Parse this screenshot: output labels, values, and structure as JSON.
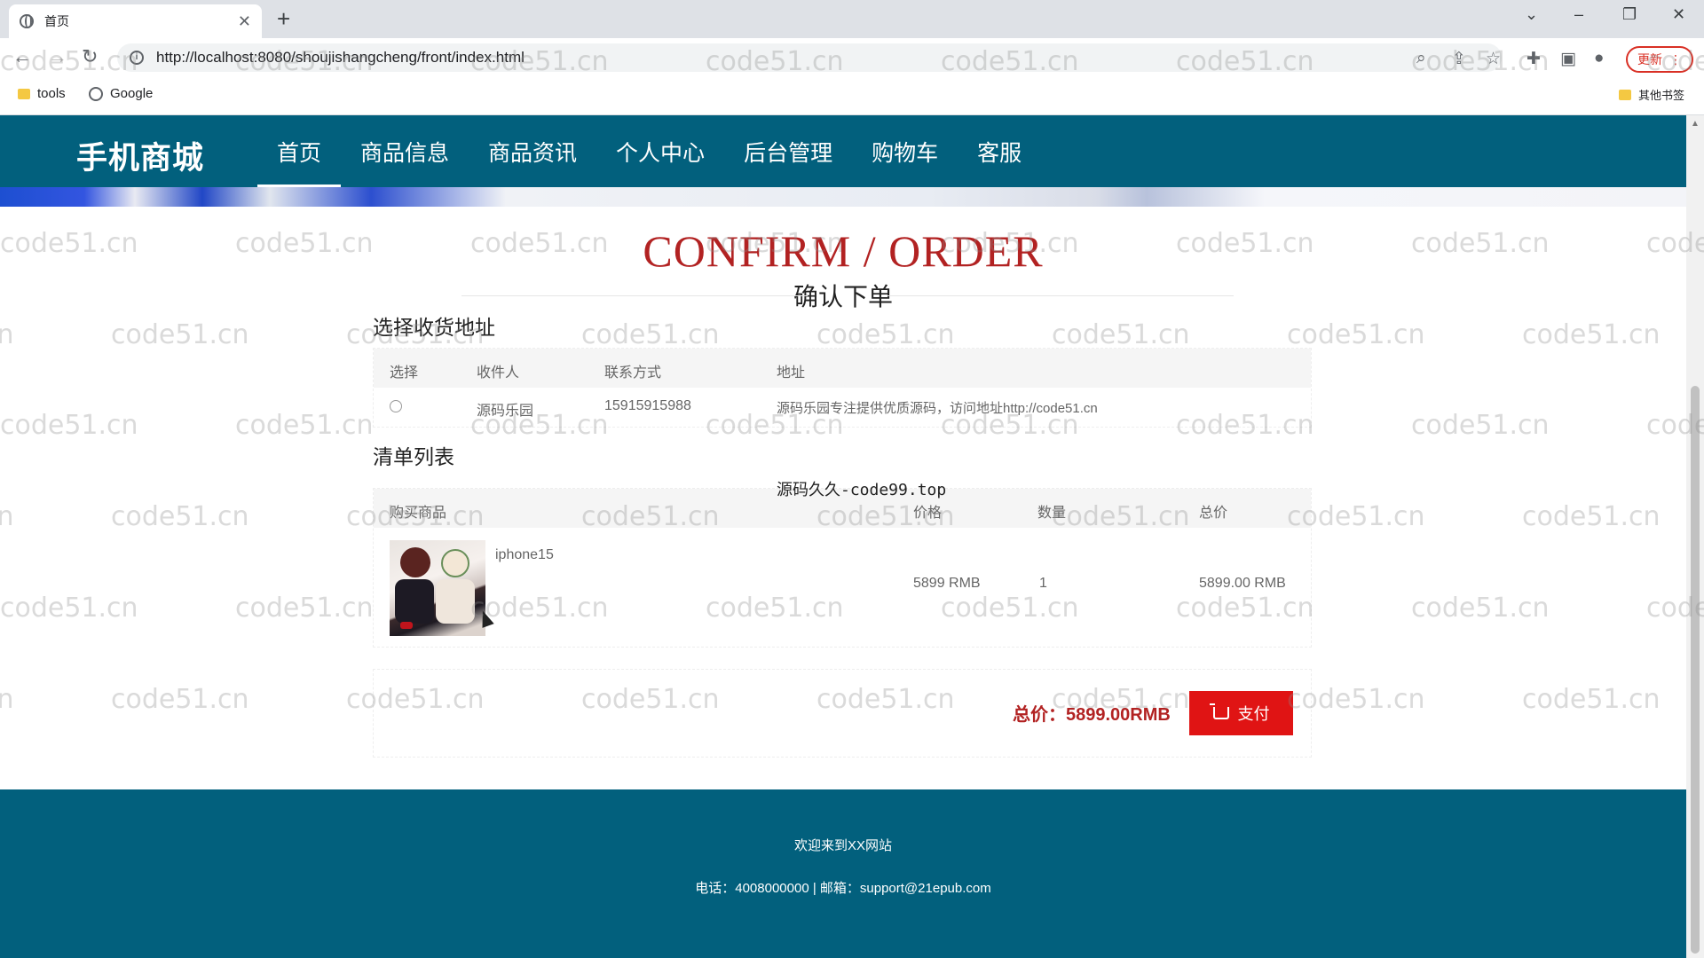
{
  "browser": {
    "tab_title": "首页",
    "url": "http://localhost:8080/shoujishangcheng/front/index.html",
    "update_label": "更新",
    "bookmarks": [
      "tools",
      "Google"
    ],
    "other_bookmarks": "其他书签"
  },
  "site": {
    "logo": "手机商城",
    "nav": [
      "首页",
      "商品信息",
      "商品资讯",
      "个人中心",
      "后台管理",
      "购物车",
      "客服"
    ],
    "active_nav": "首页"
  },
  "page": {
    "title_en": "CONFIRM / ORDER",
    "title_cn": "确认下单"
  },
  "address_section": {
    "heading": "选择收货地址",
    "columns": [
      "选择",
      "收件人",
      "联系方式",
      "地址"
    ],
    "rows": [
      {
        "recipient": "源码乐园",
        "phone": "15915915988",
        "address": "源码乐园专注提供优质源码，访问地址http://code51.cn"
      }
    ]
  },
  "list_section": {
    "heading": "清单列表",
    "columns": [
      "购买商品",
      "价格",
      "数量",
      "总价"
    ],
    "items": [
      {
        "name": "iphone15",
        "price": "5899 RMB",
        "quantity": "1",
        "total": "5899.00 RMB"
      }
    ]
  },
  "checkout": {
    "total_label": "总价：5899.00RMB",
    "pay_label": "支付"
  },
  "footer": {
    "welcome": "欢迎来到XX网站",
    "contact": "电话：4008000000 | 邮箱：support@21epub.com"
  },
  "overlay": {
    "watermark": "code51.cn",
    "center_text": "源码久久-code99.top"
  },
  "colors": {
    "brand": "#02607d",
    "accent_red": "#e01414",
    "title_red": "#b22222"
  }
}
